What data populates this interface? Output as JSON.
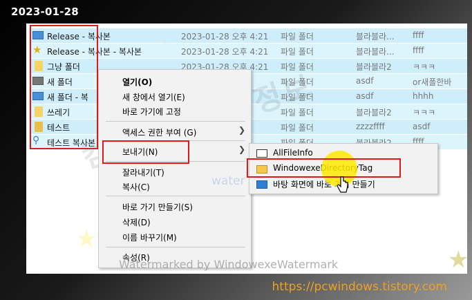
{
  "date_label": "2023-01-28",
  "site_url": "https://pcwindows.tistory.com",
  "files": [
    {
      "icon": "pc-icon",
      "name": "Release - 복사본",
      "date": "2023-01-28 오후 4:21",
      "type": "파일 폴더",
      "col3": "블라블라...",
      "col4": "ffff"
    },
    {
      "icon": "star-icon",
      "name": "Release - 복사본 - 복사본",
      "date": "2023-01-28 오후 4:21",
      "type": "파일 폴더",
      "col3": "블라블라...",
      "col4": "ffff"
    },
    {
      "icon": "folder-icon",
      "name": "그냥 폴더",
      "date": "2023-01-28 오후 4:21",
      "type": "파일 폴더",
      "col3": "블라블라2",
      "col4": "ㅋㅋㅋ"
    },
    {
      "icon": "pc-icon",
      "name": "새 폴더",
      "date": "21",
      "type": "파일 폴더",
      "col3": "asdf",
      "col4": "or새폴한바"
    },
    {
      "icon": "pc-icon",
      "name": "새 폴더 - 복",
      "date": "21",
      "type": "파일 폴더",
      "col3": "asdf",
      "col4": "hhhh"
    },
    {
      "icon": "folder-icon",
      "name": "쓰레기",
      "date": "21",
      "type": "파일 폴더",
      "col3": "블라블라2",
      "col4": "ㅋㅋㅋ"
    },
    {
      "icon": "folder-icon",
      "name": "테스트",
      "date": "21",
      "type": "파일 폴더",
      "col3": "zzzzffff",
      "col4": "asdf"
    },
    {
      "icon": "search-icon",
      "name": "테스트 복사본",
      "date": "21",
      "type": "파일 폴더",
      "col3": "블라블라2",
      "col4": "ffff"
    }
  ],
  "context_menu": {
    "open": "열기(O)",
    "open_new_window": "새 창에서 열기(E)",
    "pin_quick_access": "바로 가기에 고정",
    "give_access": "액세스 권한 부여 (G)",
    "send_to": "보내기(N)",
    "cut": "잘라내기(T)",
    "copy": "복사(C)",
    "create_shortcut": "바로 가기 만들기(S)",
    "delete": "삭제(D)",
    "rename": "이름 바꾸기(M)",
    "properties": "속성(R)"
  },
  "submenu": {
    "item1": "AllFileInfo",
    "item2": "WindowexeDirectoryTag",
    "item3": "바탕 화면에 바로 가기 만들기"
  },
  "watermark_big": "컴퓨터 관련 정보",
  "watermark_mid": "water",
  "watermark_small": "Watermarked by WindowexeWatermark",
  "colors": {
    "row_highlight": "#cdeefa",
    "red_box": "#e01818",
    "url_text": "#f0a020"
  }
}
